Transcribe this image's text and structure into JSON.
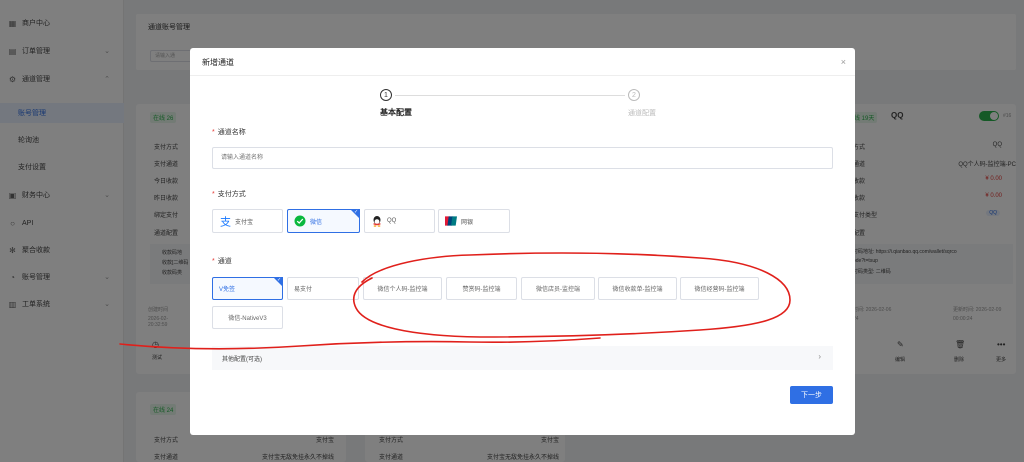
{
  "sidebar": {
    "items": [
      {
        "label": "商户中心",
        "icon": "grid-icon"
      },
      {
        "label": "订单管理",
        "icon": "document-icon"
      },
      {
        "label": "通道管理",
        "icon": "gear-icon"
      },
      {
        "label": "账号管理",
        "icon": ""
      },
      {
        "label": "轮询池",
        "icon": ""
      },
      {
        "label": "支付设置",
        "icon": ""
      },
      {
        "label": "财务中心",
        "icon": "wallet-icon"
      },
      {
        "label": "API",
        "icon": "api-icon"
      },
      {
        "label": "聚合收款",
        "icon": "qr-icon"
      },
      {
        "label": "账号管理",
        "icon": "user-icon"
      },
      {
        "label": "工单系统",
        "icon": "ticket-icon"
      }
    ]
  },
  "background": {
    "page_title": "通道账号管理",
    "search_placeholder": "请输入通",
    "card_left": {
      "online": "在线 26",
      "rows": [
        "支付方式",
        "支付通道",
        "今日收款",
        "昨日收款",
        "绑定支付",
        "通道配置"
      ],
      "notes": [
        "收款码地",
        "收款[二维码",
        "收款码类"
      ],
      "created": "创建时间",
      "created_time": "2026-02-\n20:32:59",
      "test_label": "测试"
    },
    "card_right": {
      "online": "在线 19天",
      "name": "QQ",
      "id": "#16",
      "rows": [
        "方式",
        "通道",
        "收款",
        "收款",
        "支付类型",
        "配置"
      ],
      "values": [
        "QQ",
        "QQ个人码-监控端-PC",
        "¥ 0.00",
        "¥ 0.00",
        "QQ"
      ],
      "qr_url": "付码地址: https://i.qianbao.qq.com/wallet/sqrco",
      "qr_tail": "ode?t=tsup",
      "qr_type": "付码类型: 二维码",
      "created": "时间: 2026-02-06",
      "created_time": "24",
      "updated": "更新时间: 2026-02-09",
      "updated_time": "00:00:24",
      "actions": [
        "编辑",
        "删除",
        "更多"
      ]
    },
    "bottom_cards": [
      {
        "online": "在线 24",
        "r1": "支付方式",
        "v1": "支付宝",
        "r2": "支付通道",
        "v2": "支付宝无敌免挂永久不掉线"
      },
      {
        "r1": "支付方式",
        "v1": "支付宝",
        "r2": "支付通道",
        "v2": "支付宝无敌免挂永久不掉线"
      }
    ]
  },
  "modal": {
    "title": "新增通道",
    "close": "×",
    "steps": [
      {
        "num": "1",
        "label": "基本配置",
        "active": true
      },
      {
        "num": "2",
        "label": "通道配置",
        "active": false
      }
    ],
    "name_label": "通道名称",
    "name_placeholder": "请输入通道名称",
    "pay_label": "支付方式",
    "pay_methods": [
      {
        "label": "支付宝",
        "icon": "alipay-icon",
        "selected": false
      },
      {
        "label": "微信",
        "icon": "wechat-icon",
        "selected": true
      },
      {
        "label": "QQ",
        "icon": "qq-icon",
        "selected": false
      },
      {
        "label": "网银",
        "icon": "unionpay-icon",
        "selected": false
      }
    ],
    "channel_label": "通道",
    "channels": [
      {
        "label": "V免签",
        "selected": true
      },
      {
        "label": "易支付",
        "selected": false
      },
      {
        "label": "微信个人码-监控端",
        "selected": false
      },
      {
        "label": "赞赏码-监控端",
        "selected": false
      },
      {
        "label": "微信店员-监控端",
        "selected": false
      },
      {
        "label": "微信收款单-监控端",
        "selected": false
      },
      {
        "label": "微信经营码-监控端",
        "selected": false
      },
      {
        "label": "微信-NativeV3",
        "selected": false
      }
    ],
    "other_config": "其他配置(可选)",
    "next": "下一步",
    "step_progress": 1
  },
  "colors": {
    "primary": "#2f6fe4",
    "success": "#2bb24c",
    "danger": "#e53935",
    "annotation": "#e0201b"
  }
}
